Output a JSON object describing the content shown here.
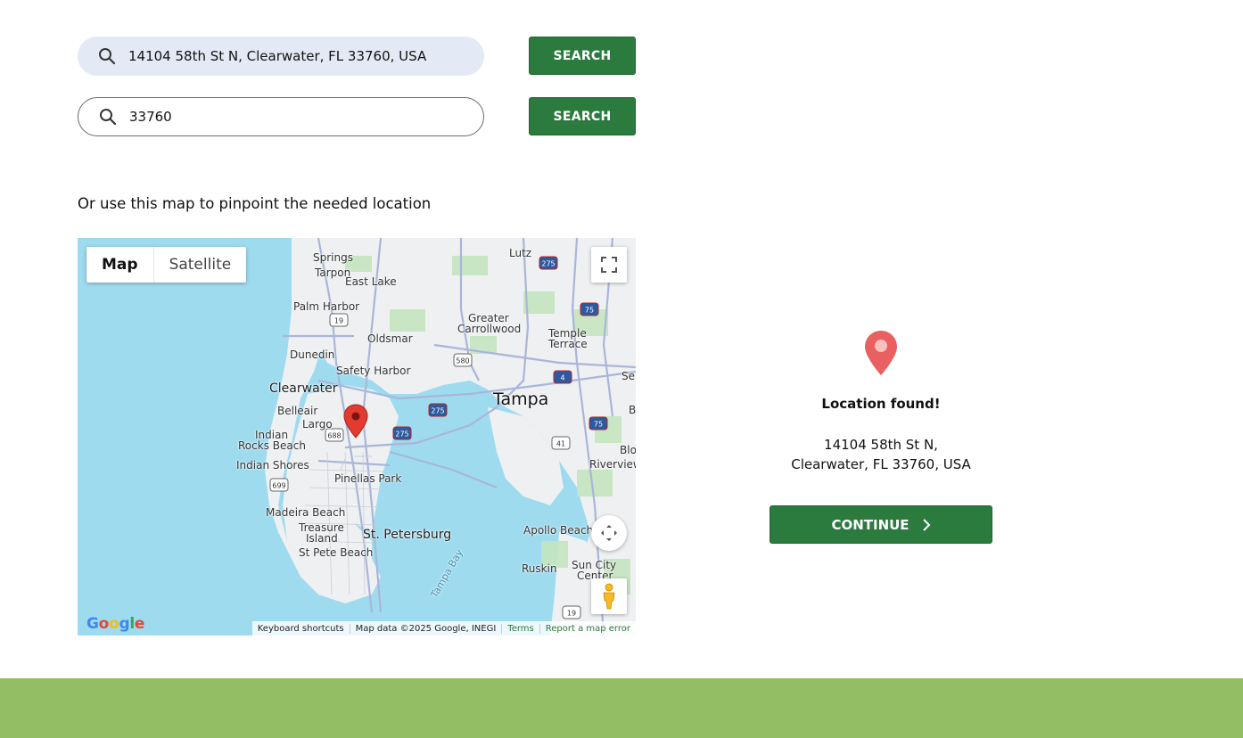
{
  "search": {
    "address_value": "14104 58th St N, Clearwater, FL 33760, USA",
    "zip_value": "33760",
    "button_label": "SEARCH"
  },
  "map_hint": "Or use this map to pinpoint the needed location",
  "map": {
    "type_map": "Map",
    "type_satellite": "Satellite",
    "labels": {
      "tarpon": "Tarpon",
      "springs": "Springs",
      "lutz": "Lutz",
      "east_lake": "East Lake",
      "palm_harbor": "Palm Harbor",
      "greater": "Greater",
      "carrollwood": "Carrollwood",
      "temple": "Temple",
      "terrace": "Terrace",
      "oldsmar": "Oldsmar",
      "dunedin": "Dunedin",
      "safety_harbor": "Safety Harbor",
      "clearwater": "Clearwater",
      "tampa": "Tampa",
      "belleair": "Belleair",
      "largo": "Largo",
      "indian_rocks_1": "Indian",
      "indian_rocks_2": "Rocks Beach",
      "indian_shores": "Indian Shores",
      "pinellas_park": "Pinellas Park",
      "riverview": "Riverview",
      "madeira": "Madeira Beach",
      "treasure_1": "Treasure",
      "treasure_2": "Island",
      "st_pete_beach": "St Pete Beach",
      "st_petersburg": "St. Petersburg",
      "apollo": "Apollo Beach",
      "ruskin": "Ruskin",
      "sun_city_1": "Sun City",
      "sun_city_2": "Center",
      "tampa_bay": "Tampa Bay",
      "se": "Se",
      "b": "B",
      "blo": "Blo"
    },
    "shields": [
      "275",
      "75",
      "19",
      "580",
      "4",
      "275",
      "688",
      "275",
      "41",
      "699",
      "75",
      "19"
    ],
    "google": "Google",
    "footer": {
      "shortcuts": "Keyboard shortcuts",
      "data": "Map data ©2025 Google, INEGI",
      "terms": "Terms",
      "report": "Report a map error"
    }
  },
  "result": {
    "title": "Location found!",
    "address_line1": "14104 58th St N,",
    "address_line2": "Clearwater, FL 33760, USA",
    "continue_label": "CONTINUE"
  },
  "colors": {
    "primary": "#2b7a3e",
    "band": "#93be63",
    "input_fill": "#e3eaf6",
    "pin": "#e8605f"
  }
}
